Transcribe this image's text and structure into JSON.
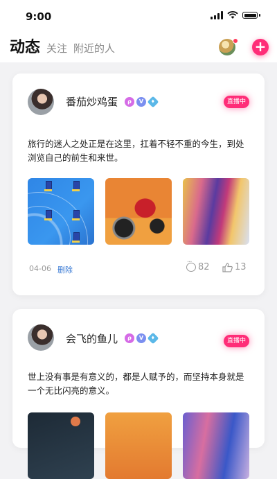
{
  "status": {
    "time": "9:00"
  },
  "nav": {
    "tabs": [
      "动态",
      "关注",
      "附近的人"
    ],
    "add_icon": "+"
  },
  "posts": [
    {
      "name": "番茄炒鸡蛋",
      "badges": [
        "ρ",
        "V",
        "♦"
      ],
      "live": "直播中",
      "text": "旅行的迷人之处正是在这里，扛着不轻不重的今生，到处浏览自己的前生和来世。",
      "date": "04-06",
      "delete": "删除",
      "comments": "82",
      "likes": "13"
    },
    {
      "name": "会飞的鱼儿",
      "badges": [
        "ρ",
        "V",
        "♦"
      ],
      "live": "直播中",
      "text": "世上没有事是有意义的，都是人赋予的，而坚持本身就是一个无比闪亮的意义。"
    }
  ]
}
